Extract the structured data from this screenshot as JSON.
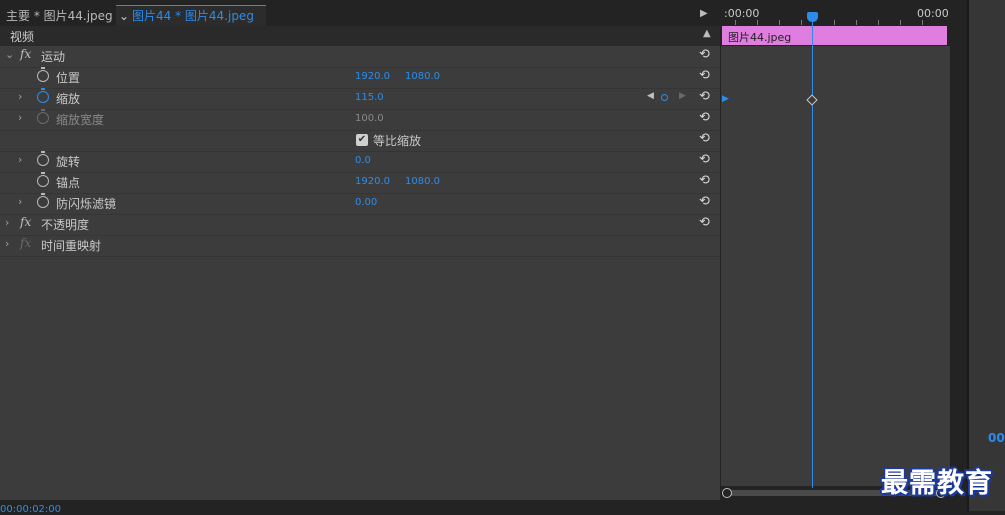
{
  "tabs": {
    "main_label": "主要 * 图片44.jpeg",
    "active_label": "图片44 * 图片44.jpeg"
  },
  "section": {
    "title": "视频"
  },
  "motion": {
    "label": "运动",
    "properties": [
      {
        "label": "位置",
        "value1": "1920.0",
        "value2": "1080.0"
      },
      {
        "label": "缩放",
        "value1": "115.0"
      },
      {
        "label": "缩放宽度",
        "value1": "100.0"
      },
      {
        "label": "等比缩放",
        "checked": true
      },
      {
        "label": "旋转",
        "value1": "0.0"
      },
      {
        "label": "锚点",
        "value1": "1920.0",
        "value2": "1080.0"
      },
      {
        "label": "防闪烁滤镜",
        "value1": "0.00"
      }
    ]
  },
  "effects": [
    {
      "label": "不透明度"
    },
    {
      "label": "时间重映射"
    }
  ],
  "timeline": {
    "ruler_start": ":00:00",
    "ruler_end": "00:00",
    "clip_name": "图片44.jpeg"
  },
  "status": {
    "timecode": "00:00:02:00"
  },
  "right_panel": {
    "timecode": "00"
  },
  "watermark": "最需教育",
  "colors": {
    "accent": "#2d8ceb",
    "clip": "#e07ee0",
    "panel": "#3c3c3c"
  }
}
